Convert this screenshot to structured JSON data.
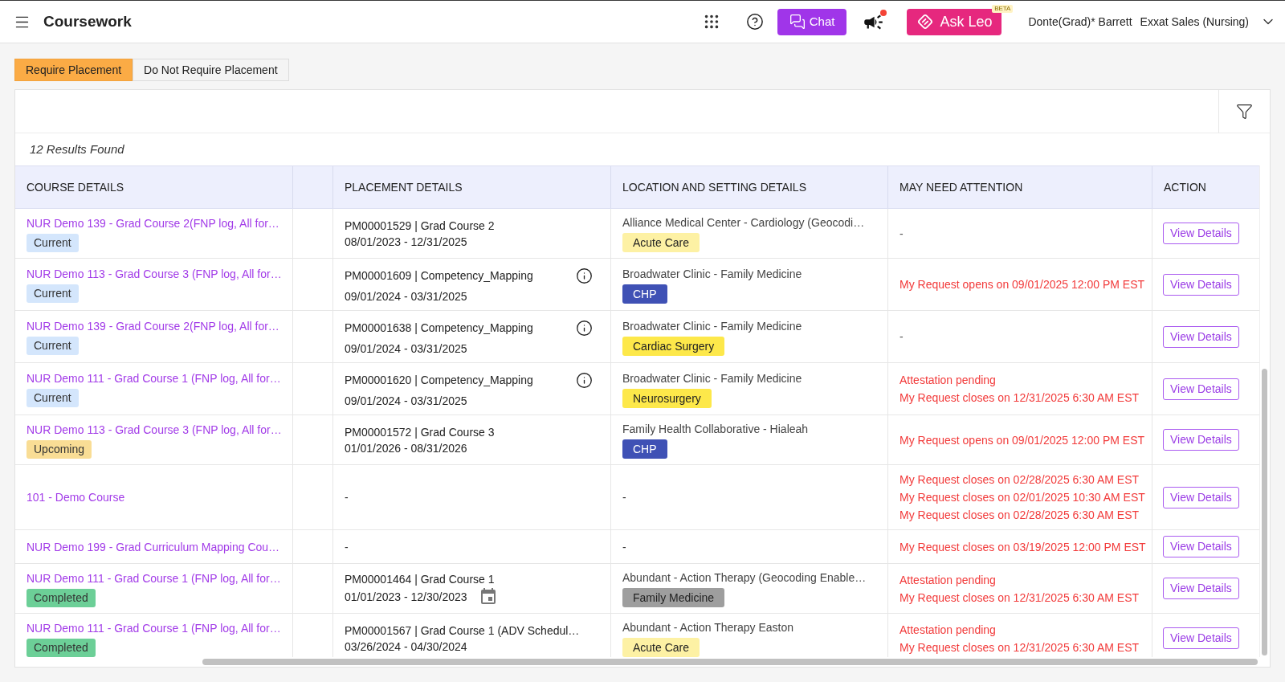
{
  "app_bar": {
    "title": "Coursework",
    "chat_button": "Chat",
    "ask_button": "Ask Leo",
    "beta_badge": "BETA",
    "user_name": "Donte(Grad)* Barrett",
    "organization": "Exxat Sales (Nursing)",
    "notification_dot": true
  },
  "placement_filter": [
    {
      "label": "Require Placement",
      "selected": true
    },
    {
      "label": "Do Not Require Placement",
      "selected": false
    }
  ],
  "results_count": "12 Results Found",
  "table": {
    "columns": [
      "COURSE DETAILS",
      "PLACEMENT DETAILS",
      "LOCATION AND SETTING DETAILS",
      "MAY NEED ATTENTION",
      "ACTION"
    ],
    "rows": [
      {
        "course": {
          "title": "NUR Demo 139 - Grad Course 2(FNP log, All for…",
          "status": {
            "label": "Current",
            "color": "#d4e6fc"
          }
        },
        "placement": {
          "title": "PM00001529 | Grad Course 2",
          "dates": "08/01/2023 - 12/31/2025",
          "info_icon": false,
          "calendar_icon": false
        },
        "location": {
          "name": "Alliance Medical Center - Cardiology (Geocodi…",
          "tag": {
            "label": "Acute Care",
            "color": "#fdf1a4"
          }
        },
        "attention": [
          {
            "text": "-",
            "alert": false
          }
        ],
        "action": "View Details"
      },
      {
        "course": {
          "title": "NUR Demo 113 - Grad Course 3 (FNP log, All for…",
          "status": {
            "label": "Current",
            "color": "#d4e6fc"
          }
        },
        "placement": {
          "title": "PM00001609 | Competency_Mapping",
          "dates": "09/01/2024 - 03/31/2025",
          "info_icon": true,
          "calendar_icon": false
        },
        "location": {
          "name": "Broadwater Clinic - Family Medicine",
          "tag": {
            "label": "CHP",
            "color": "#3f51b5"
          }
        },
        "attention": [
          {
            "text": "My Request opens on 09/01/2025 12:00 PM EST",
            "alert": true
          }
        ],
        "action": "View Details"
      },
      {
        "course": {
          "title": "NUR Demo 139 - Grad Course 2(FNP log, All for…",
          "status": {
            "label": "Current",
            "color": "#d4e6fc"
          }
        },
        "placement": {
          "title": "PM00001638 | Competency_Mapping",
          "dates": "09/01/2024 - 03/31/2025",
          "info_icon": true,
          "calendar_icon": false
        },
        "location": {
          "name": "Broadwater Clinic - Family Medicine",
          "tag": {
            "label": "Cardiac Surgery",
            "color": "#fde84a"
          }
        },
        "attention": [
          {
            "text": "-",
            "alert": false
          }
        ],
        "action": "View Details"
      },
      {
        "course": {
          "title": "NUR Demo 111 - Grad Course 1 (FNP log, All for…",
          "status": {
            "label": "Current",
            "color": "#d4e6fc"
          }
        },
        "placement": {
          "title": "PM00001620 | Competency_Mapping",
          "dates": "09/01/2024 - 03/31/2025",
          "info_icon": true,
          "calendar_icon": false
        },
        "location": {
          "name": "Broadwater Clinic - Family Medicine",
          "tag": {
            "label": "Neurosurgery",
            "color": "#fde84a"
          }
        },
        "attention": [
          {
            "text": "Attestation pending",
            "alert": true
          },
          {
            "text": "My Request closes on 12/31/2025 6:30 AM EST",
            "alert": true
          }
        ],
        "action": "View Details"
      },
      {
        "course": {
          "title": "NUR Demo 113 - Grad Course 3 (FNP log, All for…",
          "status": {
            "label": "Upcoming",
            "color": "#f9dd95"
          }
        },
        "placement": {
          "title": "PM00001572 | Grad Course 3",
          "dates": "01/01/2026 - 08/31/2026",
          "info_icon": false,
          "calendar_icon": false
        },
        "location": {
          "name": "Family Health Collaborative - Hialeah",
          "tag": {
            "label": "CHP",
            "color": "#3f51b5"
          }
        },
        "attention": [
          {
            "text": "My Request opens on 09/01/2025 12:00 PM EST",
            "alert": true
          }
        ],
        "action": "View Details"
      },
      {
        "course": {
          "title": "101 - Demo Course"
        },
        "placement": {
          "text": "-"
        },
        "location": {
          "text": "-"
        },
        "attention": [
          {
            "text": "My Request closes on 02/28/2025 6:30 AM EST",
            "alert": true
          },
          {
            "text": "My Request closes on 02/01/2025 10:30 AM EST",
            "alert": true
          },
          {
            "text": "My Request closes on 02/28/2025 6:30 AM EST",
            "alert": true
          }
        ],
        "action": "View Details"
      },
      {
        "course": {
          "title": "NUR Demo 199 - Grad Curriculum Mapping Cou…"
        },
        "placement": {
          "text": "-"
        },
        "location": {
          "text": "-"
        },
        "attention": [
          {
            "text": "My Request closes on 03/19/2025 12:00 PM EST",
            "alert": true
          }
        ],
        "action": "View Details"
      },
      {
        "course": {
          "title": "NUR Demo 111 - Grad Course 1 (FNP log, All for…",
          "status": {
            "label": "Completed",
            "color": "#6ccf97"
          }
        },
        "placement": {
          "title": "PM00001464 | Grad Course 1",
          "dates": "01/01/2023 - 12/30/2023",
          "info_icon": false,
          "calendar_icon": true
        },
        "location": {
          "name": "Abundant - Action Therapy (Geocoding Enable…",
          "tag": {
            "label": "Family Medicine",
            "color": "#9e9e9e"
          }
        },
        "attention": [
          {
            "text": "Attestation pending",
            "alert": true
          },
          {
            "text": "My Request closes on 12/31/2025 6:30 AM EST",
            "alert": true
          }
        ],
        "action": "View Details"
      },
      {
        "course": {
          "title": "NUR Demo 111 - Grad Course 1 (FNP log, All for…",
          "status": {
            "label": "Completed",
            "color": "#6ccf97"
          }
        },
        "placement": {
          "title": "PM00001567 | Grad Course 1 (ADV Schedul…",
          "dates": "03/26/2024 - 04/30/2024",
          "info_icon": false,
          "calendar_icon": false
        },
        "location": {
          "name": "Abundant - Action Therapy Easton",
          "tag": {
            "label": "Acute Care",
            "color": "#fdf1a4"
          }
        },
        "attention": [
          {
            "text": "Attestation pending",
            "alert": true
          },
          {
            "text": "My Request closes on 12/31/2025 6:30 AM EST",
            "alert": true
          }
        ],
        "action": "View Details"
      }
    ]
  }
}
